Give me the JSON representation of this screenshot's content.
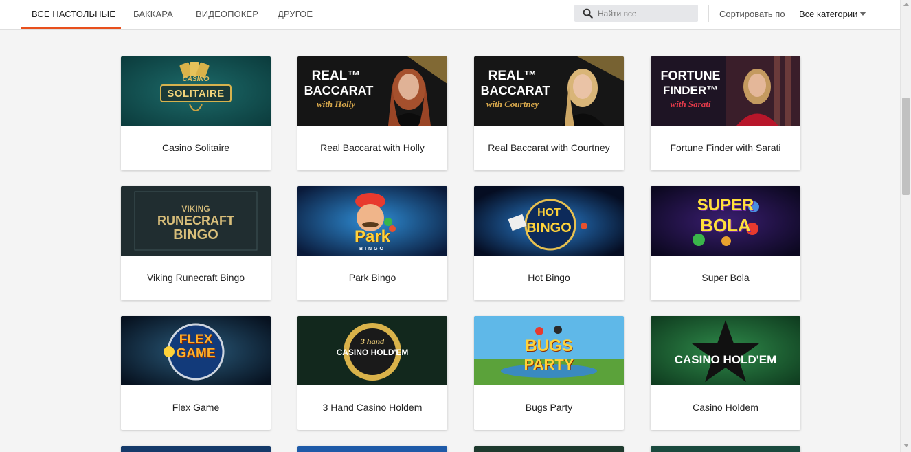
{
  "header": {
    "tabs": [
      {
        "label": "ВСЕ НАСТОЛЬНЫЕ",
        "active": true
      },
      {
        "label": "БАККАРА",
        "active": false
      },
      {
        "label": "ВИДЕОПОКЕР",
        "active": false
      },
      {
        "label": "ДРУГОЕ",
        "active": false
      }
    ],
    "search": {
      "placeholder": "Найти все",
      "value": ""
    },
    "sort_label": "Сортировать по",
    "category_selected": "Все категории",
    "accent_color": "#e8501d"
  },
  "games": [
    {
      "title": "Casino Solitaire",
      "art": {
        "line1": "CASINO",
        "line2": "SOLITAIRE"
      }
    },
    {
      "title": "Real Baccarat with Holly",
      "art": {
        "line1": "REAL™",
        "line2": "BACCARAT",
        "line3": "with Holly"
      }
    },
    {
      "title": "Real Baccarat with Courtney",
      "art": {
        "line1": "REAL™",
        "line2": "BACCARAT",
        "line3": "with Courtney"
      }
    },
    {
      "title": "Fortune Finder with Sarati",
      "art": {
        "line1": "FORTUNE",
        "line2": "FINDER™",
        "line3": "with Sarati"
      }
    },
    {
      "title": "Viking Runecraft Bingo",
      "art": {
        "line1": "VIKING",
        "line2": "RUNECRAFT",
        "line3": "BINGO"
      }
    },
    {
      "title": "Park Bingo",
      "art": {
        "line1": "Park",
        "line2": "BINGO"
      }
    },
    {
      "title": "Hot Bingo",
      "art": {
        "line1": "HOT",
        "line2": "BINGO"
      }
    },
    {
      "title": "Super Bola",
      "art": {
        "line1": "SUPER",
        "line2": "BOLA"
      }
    },
    {
      "title": "Flex Game",
      "art": {
        "line1": "FLEX",
        "line2": "GAME"
      }
    },
    {
      "title": "3 Hand Casino Holdem",
      "art": {
        "line1": "3 hand",
        "line2": "CASINO HOLD'EM"
      }
    },
    {
      "title": "Bugs Party",
      "art": {
        "line1": "BUGS",
        "line2": "PARTY"
      }
    },
    {
      "title": "Casino Holdem",
      "art": {
        "line1": "CASINO HOLD'EM"
      }
    }
  ]
}
